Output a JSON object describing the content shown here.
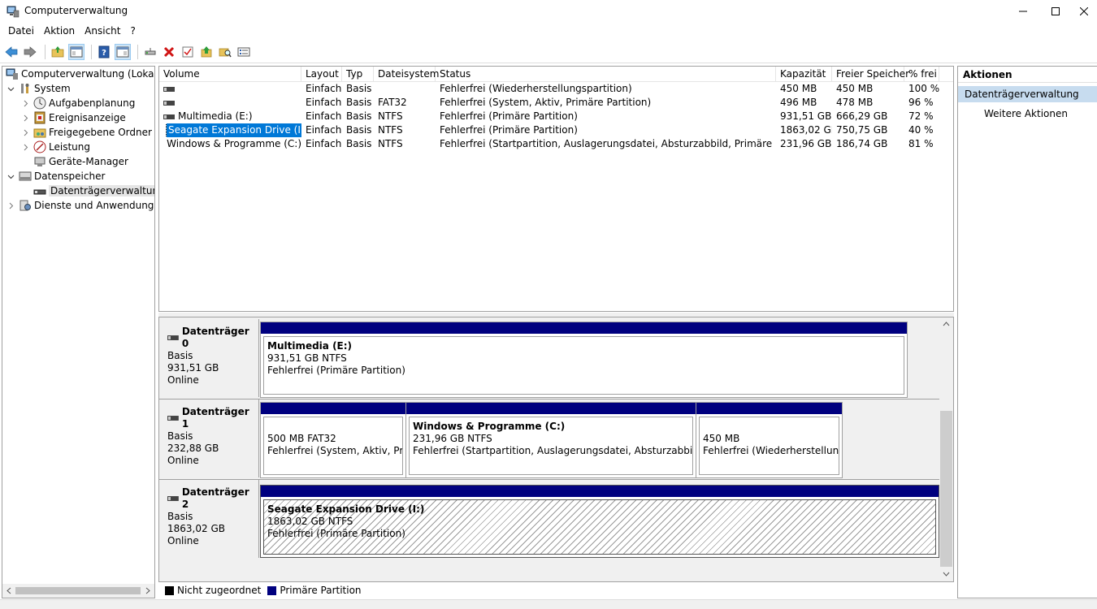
{
  "window": {
    "title": "Computerverwaltung"
  },
  "menu": [
    "Datei",
    "Aktion",
    "Ansicht",
    "?"
  ],
  "tree": {
    "root": "Computerverwaltung (Lokal)",
    "system": "System",
    "aufgaben": "Aufgabenplanung",
    "ereignis": "Ereignisanzeige",
    "freigegeben": "Freigegebene Ordner",
    "leistung": "Leistung",
    "geraete": "Geräte-Manager",
    "datenspeicher": "Datenspeicher",
    "datentraeger": "Datenträgerverwaltung",
    "dienste": "Dienste und Anwendungen"
  },
  "columns": {
    "volume": "Volume",
    "layout": "Layout",
    "typ": "Typ",
    "dateisystem": "Dateisystem",
    "status": "Status",
    "kapazitaet": "Kapazität",
    "frei": "Freier Speicher",
    "prozent": "% frei"
  },
  "volumes": [
    {
      "name": "",
      "layout": "Einfach",
      "typ": "Basis",
      "fs": "",
      "status": "Fehlerfrei (Wiederherstellungspartition)",
      "kap": "450 MB",
      "frei": "450 MB",
      "pct": "100 %"
    },
    {
      "name": "",
      "layout": "Einfach",
      "typ": "Basis",
      "fs": "FAT32",
      "status": "Fehlerfrei (System, Aktiv, Primäre Partition)",
      "kap": "496 MB",
      "frei": "478 MB",
      "pct": "96 %"
    },
    {
      "name": "Multimedia (E:)",
      "layout": "Einfach",
      "typ": "Basis",
      "fs": "NTFS",
      "status": "Fehlerfrei (Primäre Partition)",
      "kap": "931,51 GB",
      "frei": "666,29 GB",
      "pct": "72 %"
    },
    {
      "name": "Seagate Expansion Drive (I:)",
      "layout": "Einfach",
      "typ": "Basis",
      "fs": "NTFS",
      "status": "Fehlerfrei (Primäre Partition)",
      "kap": "1863,02 GB",
      "frei": "750,75 GB",
      "pct": "40 %"
    },
    {
      "name": "Windows & Programme (C:)",
      "layout": "Einfach",
      "typ": "Basis",
      "fs": "NTFS",
      "status": "Fehlerfrei (Startpartition, Auslagerungsdatei, Absturzabbild, Primäre Partition)",
      "kap": "231,96 GB",
      "frei": "186,74 GB",
      "pct": "81 %"
    }
  ],
  "disks": [
    {
      "title": "Datenträger 0",
      "type": "Basis",
      "size": "931,51 GB",
      "state": "Online",
      "partitions": [
        {
          "name": "Multimedia  (E:)",
          "line1": "931,51 GB NTFS",
          "line2": "Fehlerfrei (Primäre Partition)"
        }
      ]
    },
    {
      "title": "Datenträger 1",
      "type": "Basis",
      "size": "232,88 GB",
      "state": "Online",
      "partitions": [
        {
          "name": "",
          "line1": "500 MB FAT32",
          "line2": "Fehlerfrei (System, Aktiv, Primä"
        },
        {
          "name": "Windows & Programme  (C:)",
          "line1": "231,96 GB NTFS",
          "line2": "Fehlerfrei (Startpartition, Auslagerungsdatei, Absturzabbild, Primä"
        },
        {
          "name": "",
          "line1": "450 MB",
          "line2": "Fehlerfrei (Wiederherstellungsp"
        }
      ]
    },
    {
      "title": "Datenträger 2",
      "type": "Basis",
      "size": "1863,02 GB",
      "state": "Online",
      "partitions": [
        {
          "name": "Seagate Expansion Drive  (I:)",
          "line1": "1863,02 GB NTFS",
          "line2": "Fehlerfrei (Primäre Partition)"
        }
      ]
    }
  ],
  "legend": {
    "unallocated": "Nicht zugeordnet",
    "primary": "Primäre Partition"
  },
  "actions": {
    "header": "Aktionen",
    "section": "Datenträgerverwaltung",
    "more": "Weitere Aktionen"
  },
  "colors": {
    "partition_bar": "#00007f",
    "unallocated": "#000000",
    "selection": "#0078d7",
    "action_section": "#c7dcef"
  }
}
